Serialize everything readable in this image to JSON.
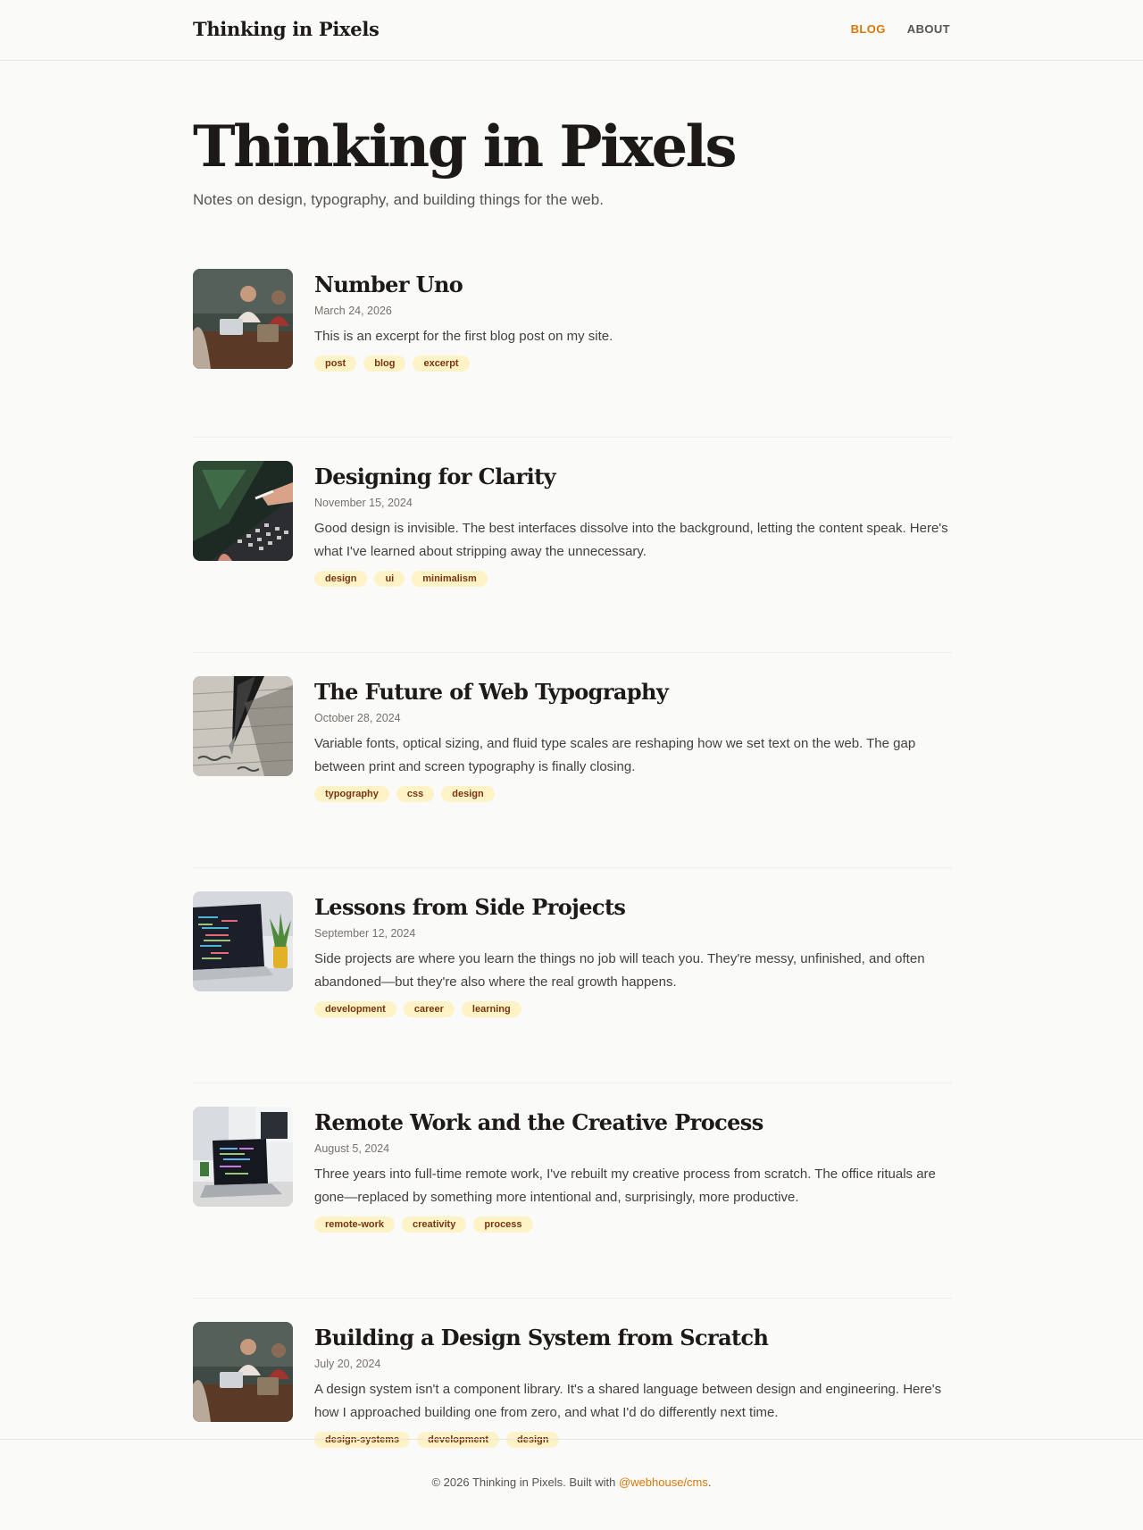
{
  "header": {
    "brand": "Thinking in Pixels",
    "nav": [
      {
        "label": "BLOG",
        "active": true
      },
      {
        "label": "ABOUT",
        "active": false
      }
    ]
  },
  "hero": {
    "title": "Thinking in Pixels",
    "subtitle": "Notes on design, typography, and building things for the web."
  },
  "posts": [
    {
      "title": "Number Uno",
      "date": "March 24, 2026",
      "excerpt": "This is an excerpt for the first blog post on my site.",
      "tags": [
        "post",
        "blog",
        "excerpt"
      ],
      "thumbnail": "people-with-laptop-photo"
    },
    {
      "title": "Designing for Clarity",
      "date": "November 15, 2024",
      "excerpt": "Good design is invisible. The best interfaces dissolve into the background, letting the content speak. Here's what I've learned about stripping away the unnecessary.",
      "tags": [
        "design",
        "ui",
        "minimalism"
      ],
      "thumbnail": "laptop-keyboard-photo"
    },
    {
      "title": "The Future of Web Typography",
      "date": "October 28, 2024",
      "excerpt": "Variable fonts, optical sizing, and fluid type scales are reshaping how we set text on the web. The gap between print and screen typography is finally closing.",
      "tags": [
        "typography",
        "css",
        "design"
      ],
      "thumbnail": "fountain-pen-photo"
    },
    {
      "title": "Lessons from Side Projects",
      "date": "September 12, 2024",
      "excerpt": "Side projects are where you learn the things no job will teach you. They're messy, unfinished, and often abandoned—but they're also where the real growth happens.",
      "tags": [
        "development",
        "career",
        "learning"
      ],
      "thumbnail": "laptop-with-code-photo"
    },
    {
      "title": "Remote Work and the Creative Process",
      "date": "August 5, 2024",
      "excerpt": "Three years into full-time remote work, I've rebuilt my creative process from scratch. The office rituals are gone—replaced by something more intentional and, surprisingly, more productive.",
      "tags": [
        "remote-work",
        "creativity",
        "process"
      ],
      "thumbnail": "desk-laptop-photo"
    },
    {
      "title": "Building a Design System from Scratch",
      "date": "July 20, 2024",
      "excerpt": "A design system isn't a component library. It's a shared language between design and engineering. Here's how I approached building one from zero, and what I'd do differently next time.",
      "tags": [
        "design-systems",
        "development",
        "design"
      ],
      "thumbnail": "people-with-laptop-photo"
    }
  ],
  "footer": {
    "text": "© 2026 Thinking in Pixels. Built with ",
    "link": "@webhouse/cms",
    "suffix": "."
  },
  "colors": {
    "accent": "#d97706",
    "tag_bg": "#fef3c7",
    "tag_text": "#78350f",
    "background": "#fafaf9"
  }
}
